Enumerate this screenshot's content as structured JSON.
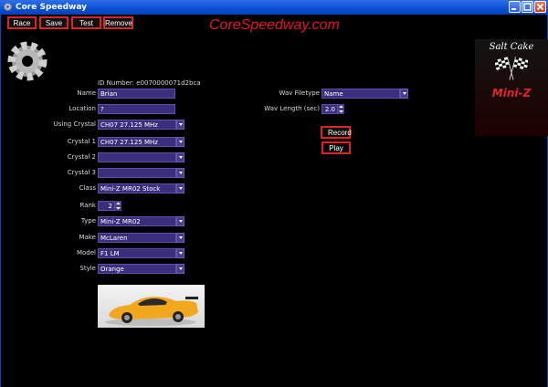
{
  "window": {
    "title": "Core Speedway"
  },
  "toolbar": {
    "race": "Race",
    "save": "Save",
    "test": "Test",
    "remove": "Remove"
  },
  "brand": "CoreSpeedway.com",
  "id_label": "ID Number: e0070000071d2bca",
  "form": {
    "name_label": "Name",
    "name_value": "Brian",
    "location_label": "Location",
    "location_value": "?",
    "using_crystal_label": "Using Crystal",
    "using_crystal_value": "CH07 27.125 MHz",
    "crystal1_label": "Crystal 1",
    "crystal1_value": "CH07 27.125 MHz",
    "crystal2_label": "Crystal 2",
    "crystal2_value": "",
    "crystal3_label": "Crystal 3",
    "crystal3_value": "",
    "class_label": "Class",
    "class_value": "Mini-Z MR02 Stock",
    "rank_label": "Rank",
    "rank_value": "2",
    "type_label": "Type",
    "type_value": "Mini-Z MR02",
    "make_label": "Make",
    "make_value": "McLaren",
    "model_label": "Model",
    "model_value": "F1 LM",
    "style_label": "Style",
    "style_value": "Orange"
  },
  "wav": {
    "filetype_label": "Wav Filetype",
    "filetype_value": "Name",
    "length_label": "Wav Length (sec)",
    "length_value": "2.0"
  },
  "buttons": {
    "record": "Record",
    "play": "Play"
  },
  "logo": {
    "top_text": "Salt Cake",
    "bottom_text": "Mini-Z"
  },
  "colors": {
    "accent_red": "#e02222",
    "field_bg": "#3b2f7d",
    "brand_red": "#e8142a"
  }
}
